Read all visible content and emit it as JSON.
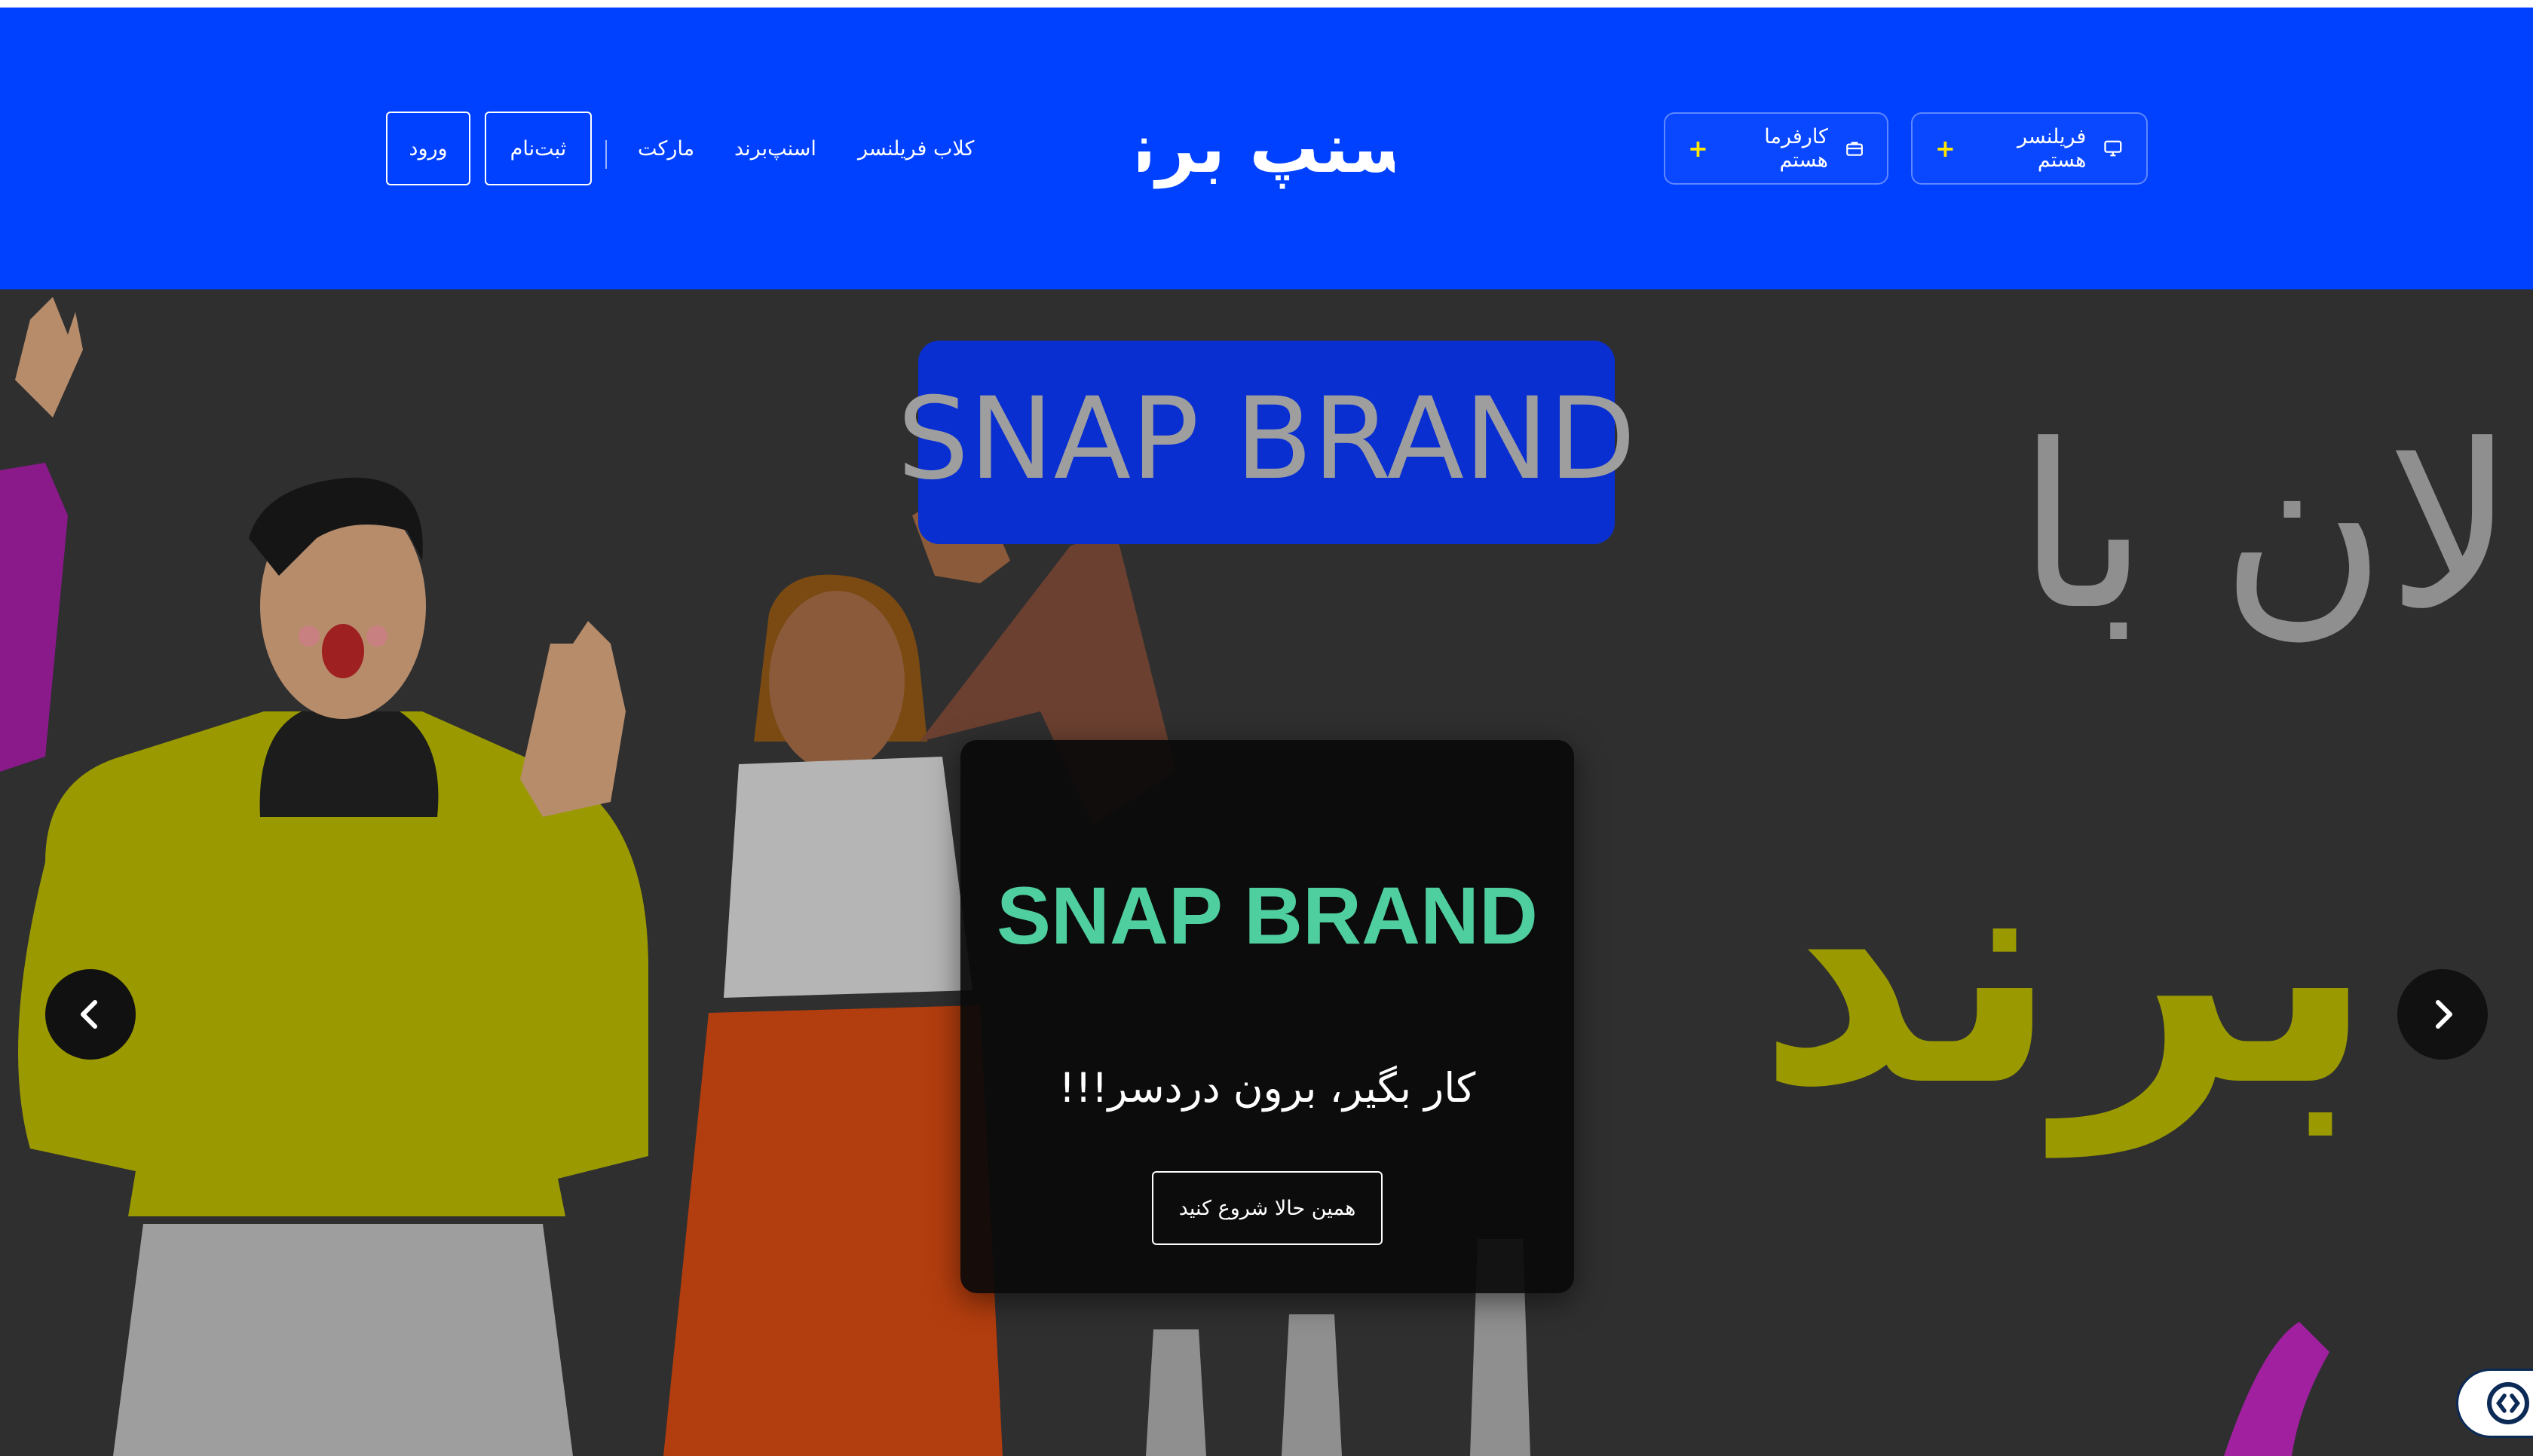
{
  "header": {
    "logo_text": "اسنپ برند",
    "auth": {
      "login_label": "ورود",
      "register_label": "ثبت‌نام"
    },
    "nav": [
      {
        "label": "مارکت"
      },
      {
        "label": "اسنپ‌برند"
      },
      {
        "label": "کلاب فریلنسر"
      }
    ],
    "roles": {
      "employer_label": "کارفرما هستم",
      "freelancer_label": "فریلنسر هستم",
      "plus": "+"
    }
  },
  "hero": {
    "sign_text": "SNAP BRAND",
    "background_text": {
      "line1": "الان با",
      "line2": "برند"
    },
    "caption": {
      "title": "SNAP BRAND",
      "subtitle": "کار بگیر، برون دردسر!!!",
      "cta_label": "همین حالا شروع کنید"
    }
  },
  "colors": {
    "header_bg": "#0041ff",
    "hero_bg": "#2f2f30",
    "accent_green": "#4fcf9f",
    "plus_yellow": "#ffe600"
  }
}
